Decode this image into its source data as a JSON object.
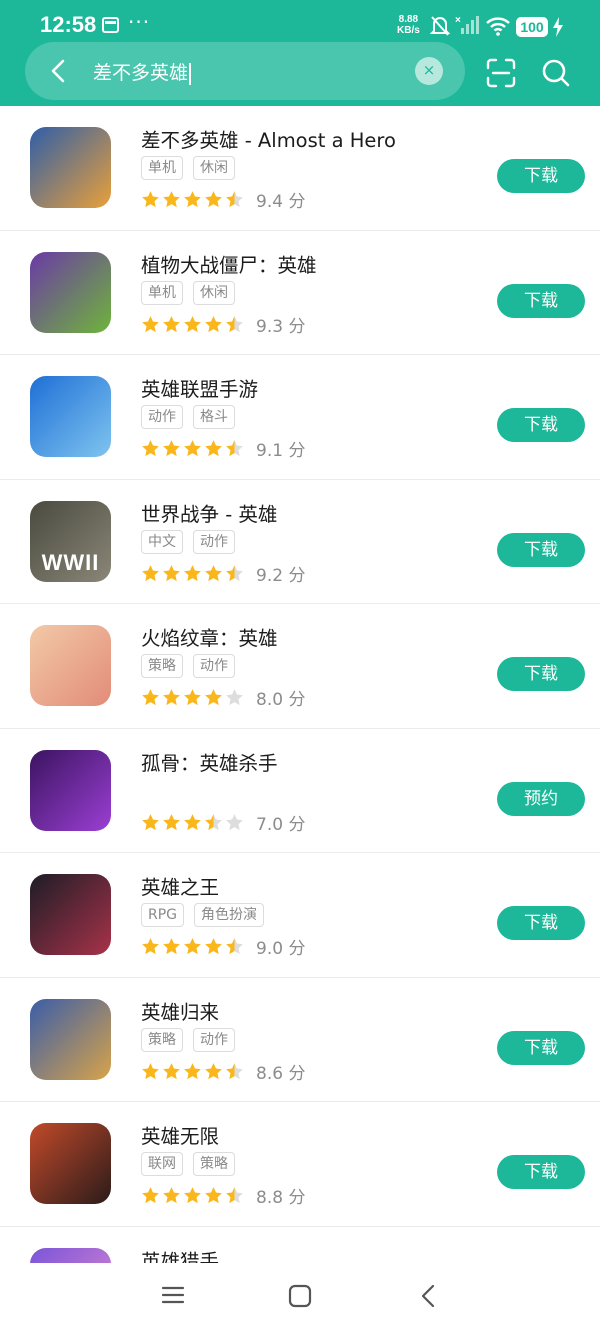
{
  "status_bar": {
    "time": "12:58",
    "dots": "···",
    "net_speed_value": "8.88",
    "net_speed_unit": "KB/s",
    "battery": "100"
  },
  "search": {
    "query": "差不多英雄",
    "clear_icon": "×"
  },
  "colors": {
    "accent": "#1cb899",
    "star": "#f9b71c",
    "star_empty": "#dddddd"
  },
  "results": [
    {
      "name": "差不多英雄 - Almost a Hero",
      "tags": [
        "单机",
        "休闲"
      ],
      "rating": 4.5,
      "score": "9.4 分",
      "action": "下载",
      "icon": "almost-a-hero-icon",
      "icon_colors": [
        "#2f5ea8",
        "#e9a03a"
      ]
    },
    {
      "name": "植物大战僵尸：英雄",
      "tags": [
        "单机",
        "休闲"
      ],
      "rating": 4.5,
      "score": "9.3 分",
      "action": "下载",
      "icon": "pvz-heroes-icon",
      "icon_colors": [
        "#6a3aa6",
        "#6fb43a"
      ]
    },
    {
      "name": "英雄联盟手游",
      "tags": [
        "动作",
        "格斗"
      ],
      "rating": 4.5,
      "score": "9.1 分",
      "action": "下载",
      "icon": "lol-mobile-icon",
      "icon_colors": [
        "#1f6fd6",
        "#7fc4ef"
      ]
    },
    {
      "name": "世界战争 - 英雄",
      "tags": [
        "中文",
        "动作"
      ],
      "rating": 4.5,
      "score": "9.2 分",
      "action": "下载",
      "icon": "world-war-heroes-icon",
      "icon_text": "WWII",
      "icon_colors": [
        "#4a4a3f",
        "#8a8778"
      ]
    },
    {
      "name": "火焰纹章：英雄",
      "tags": [
        "策略",
        "动作"
      ],
      "rating": 4,
      "score": "8.0 分",
      "action": "下载",
      "icon": "fire-emblem-heroes-icon",
      "icon_colors": [
        "#f2c9a8",
        "#e28c78"
      ]
    },
    {
      "name": "孤骨：英雄杀手",
      "tags": [],
      "rating": 3.5,
      "score": "7.0 分",
      "action": "预约",
      "icon": "skul-hero-slayer-icon",
      "icon_colors": [
        "#3b1460",
        "#9b3fd4"
      ]
    },
    {
      "name": "英雄之王",
      "tags": [
        "RPG",
        "角色扮演"
      ],
      "rating": 4.5,
      "score": "9.0 分",
      "action": "下载",
      "icon": "king-of-heroes-icon",
      "icon_colors": [
        "#1d1d26",
        "#a8324a"
      ]
    },
    {
      "name": "英雄归来",
      "tags": [
        "策略",
        "动作"
      ],
      "rating": 4.5,
      "score": "8.6 分",
      "action": "下载",
      "icon": "heroes-return-icon",
      "icon_colors": [
        "#3a5da8",
        "#d8a34a"
      ]
    },
    {
      "name": "英雄无限",
      "tags": [
        "联网",
        "策略"
      ],
      "rating": 4.5,
      "score": "8.8 分",
      "action": "下载",
      "icon": "heroes-infinity-icon",
      "icon_colors": [
        "#c14a2a",
        "#2b1b1a"
      ]
    },
    {
      "name": "英雄猎手",
      "tags": [],
      "rating": 0,
      "score": "",
      "action": "",
      "icon": "hero-hunters-icon",
      "icon_colors": [
        "#7a55d8",
        "#e58ad0"
      ]
    }
  ]
}
